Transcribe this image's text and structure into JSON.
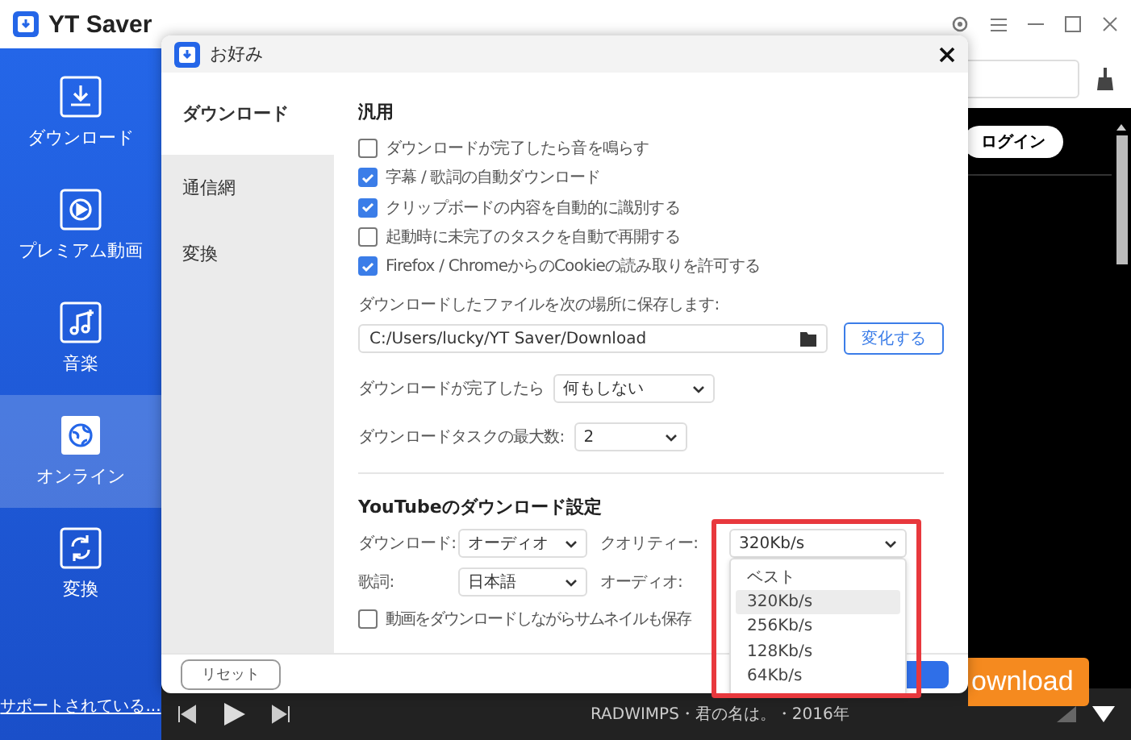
{
  "app": {
    "title": "YT Saver"
  },
  "sidebar": {
    "items": [
      {
        "label": "ダウンロード",
        "kind": "download",
        "selected": false
      },
      {
        "label": "プレミアム動画",
        "kind": "play",
        "selected": false
      },
      {
        "label": "音楽",
        "kind": "music",
        "selected": false
      },
      {
        "label": "オンライン",
        "kind": "globe",
        "selected": true
      },
      {
        "label": "変換",
        "kind": "convert",
        "selected": false
      }
    ],
    "support_link": "サポートされている..."
  },
  "browser": {
    "login_button": "ログイン",
    "now_playing": "RADWIMPS・君の名は。・2016年",
    "download_button": "ownload"
  },
  "dialog": {
    "title": "お好み",
    "nav": [
      {
        "label": "ダウンロード",
        "selected": true
      },
      {
        "label": "通信網",
        "selected": false
      },
      {
        "label": "変換",
        "selected": false
      }
    ],
    "general": {
      "heading": "汎用",
      "options": [
        {
          "label": "ダウンロードが完了したら音を鳴らす",
          "checked": false
        },
        {
          "label": "字幕 / 歌詞の自動ダウンロード",
          "checked": true
        },
        {
          "label": "クリップボードの内容を自動的に識別する",
          "checked": true
        },
        {
          "label": "起動時に未完了のタスクを自動で再開する",
          "checked": false
        },
        {
          "label": "Firefox / ChromeからのCookieの読み取りを許可する",
          "checked": true
        }
      ],
      "save_path_label": "ダウンロードしたファイルを次の場所に保存します:",
      "save_path": "C:/Users/lucky/YT Saver/Download",
      "change_button": "変化する",
      "after_done": {
        "label": "ダウンロードが完了したら",
        "value": "何もしない"
      },
      "max_tasks": {
        "label": "ダウンロードタスクの最大数:",
        "value": "2"
      }
    },
    "youtube": {
      "heading": "YouTubeのダウンロード設定",
      "download": {
        "label": "ダウンロード:",
        "value": "オーディオ"
      },
      "quality": {
        "label": "クオリティー:",
        "value": "320Kb/s"
      },
      "lyrics": {
        "label": "歌詞:",
        "value": "日本語"
      },
      "audio": {
        "label": "オーディオ:"
      },
      "thumbnail": {
        "label": "動画をダウンロードしながらサムネイルも保存",
        "checked": false
      }
    },
    "reset_button": "リセット"
  },
  "quality_dropdown": {
    "options": [
      {
        "label": "ベスト",
        "selected": false
      },
      {
        "label": "320Kb/s",
        "selected": true
      },
      {
        "label": "256Kb/s",
        "selected": false
      },
      {
        "label": "128Kb/s",
        "selected": false
      },
      {
        "label": "64Kb/s",
        "selected": false
      }
    ]
  }
}
